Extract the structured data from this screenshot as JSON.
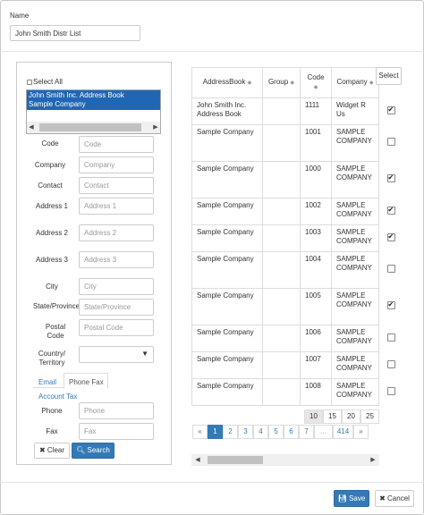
{
  "name": {
    "label": "Name",
    "value": "John Smith Distr List"
  },
  "left": {
    "select_all": "Select All",
    "list_items": [
      "John Smith Inc. Address Book",
      "Sample Company"
    ],
    "fields": [
      {
        "label": "Code",
        "placeholder": "Code"
      },
      {
        "label": "Company",
        "placeholder": "Company"
      },
      {
        "label": "Contact",
        "placeholder": "Contact"
      },
      {
        "label": "Address 1",
        "placeholder": "Address 1"
      },
      {
        "label": "Address 2",
        "placeholder": "Address 2"
      },
      {
        "label": "Address 3",
        "placeholder": "Address 3"
      },
      {
        "label": "City",
        "placeholder": "City"
      },
      {
        "label": "State/Province",
        "placeholder": "State/Province"
      },
      {
        "label": "Postal Code",
        "placeholder": "Postal Code"
      },
      {
        "label": "Country/ Territory",
        "placeholder": ""
      }
    ],
    "tabs": [
      "Email",
      "Phone Fax",
      "Account Tax"
    ],
    "phone": {
      "label": "Phone",
      "placeholder": "Phone"
    },
    "fax": {
      "label": "Fax",
      "placeholder": "Fax"
    },
    "clear_label": "Clear",
    "search_label": "Search"
  },
  "grid": {
    "headers": [
      "AddressBook",
      "Group",
      "Code",
      "Company"
    ],
    "select_label": "Select",
    "rows": [
      {
        "address_book": "John Smith Inc. Address Book",
        "group": "",
        "code": "1111",
        "company": "Widget R Us",
        "checked": true
      },
      {
        "address_book": "Sample Company",
        "group": "",
        "code": "1001",
        "company": "SAMPLE COMPANY",
        "checked": false
      },
      {
        "address_book": "Sample Company",
        "group": "",
        "code": "1000",
        "company": "SAMPLE COMPANY",
        "checked": true
      },
      {
        "address_book": "Sample Company",
        "group": "",
        "code": "1002",
        "company": "SAMPLE COMPANY",
        "checked": true
      },
      {
        "address_book": "Sample Company",
        "group": "",
        "code": "1003",
        "company": "SAMPLE COMPANY",
        "checked": true
      },
      {
        "address_book": "Sample Company",
        "group": "",
        "code": "1004",
        "company": "SAMPLE COMPANY",
        "checked": false
      },
      {
        "address_book": "Sample Company",
        "group": "",
        "code": "1005",
        "company": "SAMPLE COMPANY",
        "checked": true
      },
      {
        "address_book": "Sample Company",
        "group": "",
        "code": "1006",
        "company": "SAMPLE COMPANY",
        "checked": false
      },
      {
        "address_book": "Sample Company",
        "group": "",
        "code": "1007",
        "company": "SAMPLE COMPANY",
        "checked": false
      },
      {
        "address_book": "Sample Company",
        "group": "",
        "code": "1008",
        "company": "SAMPLE COMPANY",
        "checked": false
      }
    ]
  },
  "page_sizes": [
    "10",
    "15",
    "20",
    "25"
  ],
  "page_size_selected": "10",
  "pager": [
    "«",
    "1",
    "2",
    "3",
    "4",
    "5",
    "6",
    "7",
    "...",
    "414",
    "»"
  ],
  "pager_current": "1",
  "footer": {
    "save_label": "Save",
    "cancel_label": "Cancel"
  },
  "colors": {
    "accent": "#337ab7",
    "selection": "#1f67b4"
  }
}
